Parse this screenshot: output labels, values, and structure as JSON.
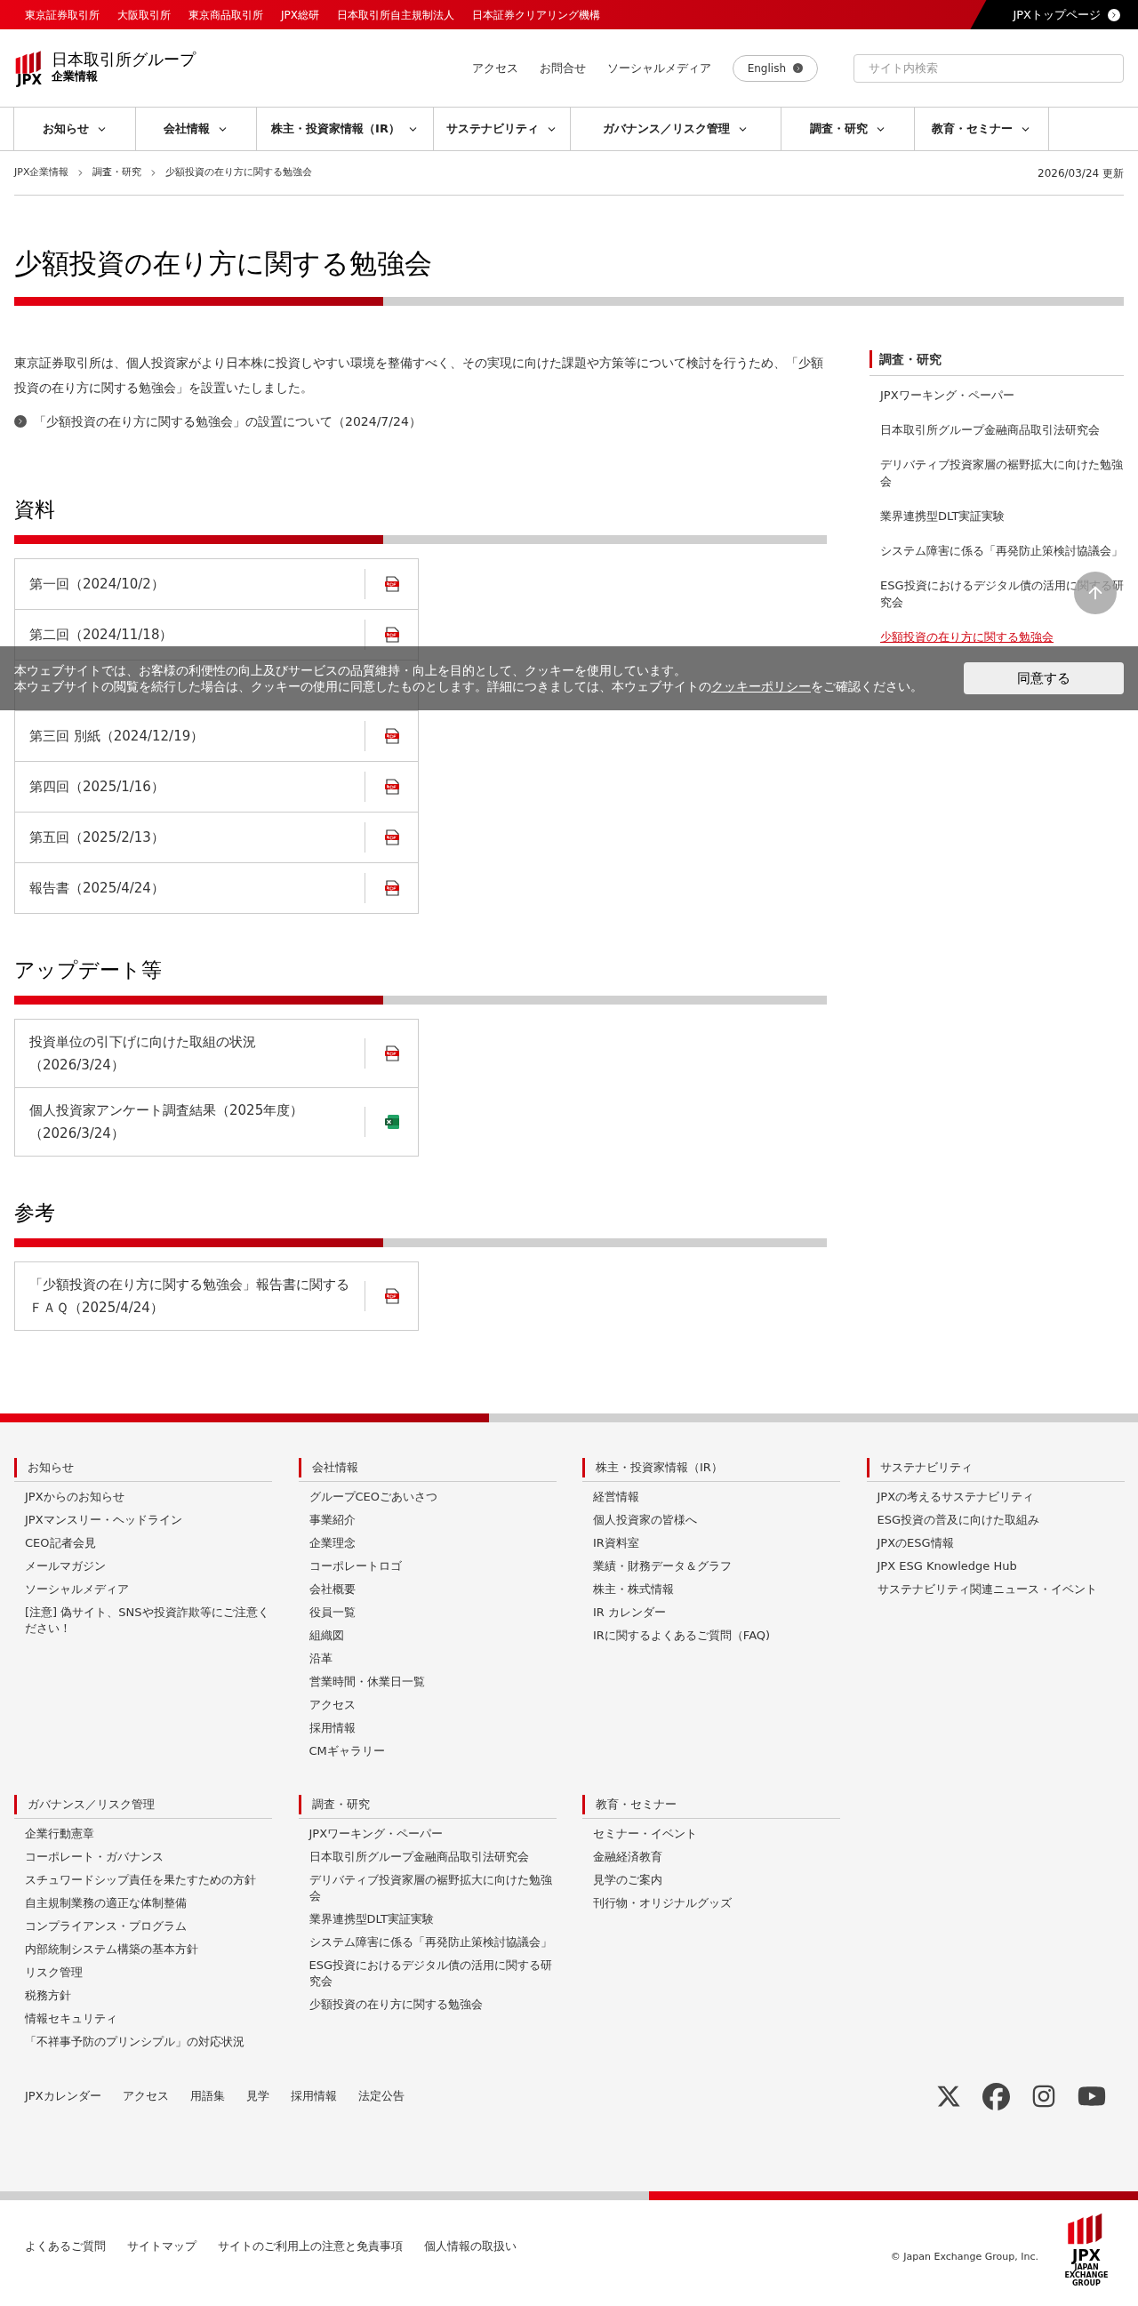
{
  "top_bar": {
    "links": [
      "東京証券取引所",
      "大阪取引所",
      "東京商品取引所",
      "JPX総研",
      "日本取引所自主規制法人",
      "日本証券クリアリング機構"
    ],
    "home_link": "JPXトップページ"
  },
  "header": {
    "logo_text": "JPX",
    "site_name": "日本取引所グループ",
    "site_sub": "企業情報",
    "links": [
      "アクセス",
      "お問合せ",
      "ソーシャルメディア"
    ],
    "language": "English",
    "search": {
      "placeholder": "サイト内検索"
    }
  },
  "nav": [
    "お知らせ",
    "会社情報",
    "株主・投資家情報（IR）",
    "サステナビリティ",
    "ガバナンス／リスク管理",
    "調査・研究",
    "教育・セミナー"
  ],
  "breadcrumb": [
    "JPX企業情報",
    "調査・研究",
    "少額投資の在り方に関する勉強会"
  ],
  "updated": "2026/03/24 更新",
  "title": "少額投資の在り方に関する勉強会",
  "intro": "東京証券取引所は、個人投資家がより日本株に投資しやすい環境を整備すべく、その実現に向けた課題や方策等について検討を行うため、「少額投資の在り方に関する勉強会」を設置いたしました。",
  "intro_link": "「少額投資の在り方に関する勉強会」の設置について（2024/7/24）",
  "sections": [
    {
      "heading": "資料",
      "items": [
        {
          "label": "第一回（2024/10/2）",
          "kind": "pdf"
        },
        {
          "label": "第二回（2024/11/18）",
          "kind": "pdf"
        },
        {
          "kind": "hidden"
        },
        {
          "label": "第三回 別紙（2024/12/19）",
          "kind": "pdf"
        },
        {
          "label": "第四回（2025/1/16）",
          "kind": "pdf"
        },
        {
          "label": "第五回（2025/2/13）",
          "kind": "pdf"
        },
        {
          "label": "報告書（2025/4/24）",
          "kind": "pdf"
        }
      ]
    },
    {
      "heading": "アップデート等",
      "items": [
        {
          "label": "投資単位の引下げに向けた取組の状況（2026/3/24）",
          "kind": "pdf"
        },
        {
          "label": "個人投資家アンケート調査結果（2025年度）（2026/3/24）",
          "kind": "excel"
        }
      ]
    },
    {
      "heading": "参考",
      "items": [
        {
          "label": "「少額投資の在り方に関する勉強会」報告書に関するＦＡＱ（2025/4/24）",
          "kind": "pdf"
        }
      ]
    }
  ],
  "sidebar": {
    "heading": "調査・研究",
    "items": [
      {
        "label": "JPXワーキング・ペーパー",
        "selected": false
      },
      {
        "label": "日本取引所グループ金融商品取引法研究会",
        "selected": false
      },
      {
        "label": "デリバティブ投資家層の裾野拡大に向けた勉強会",
        "selected": false
      },
      {
        "label": "業界連携型DLT実証実験",
        "selected": false
      },
      {
        "label": "システム障害に係る「再発防止策検討協議会」",
        "selected": false
      },
      {
        "label": "ESG投資におけるデジタル債の活用に関する研究会",
        "selected": false
      },
      {
        "label": "少額投資の在り方に関する勉強会",
        "selected": true
      }
    ]
  },
  "cookie_banner": {
    "line1": "本ウェブサイトでは、お客様の利便性の向上及びサービスの品質維持・向上を目的として、クッキーを使用しています。",
    "line2_before": "本ウェブサイトの閲覧を続行した場合は、クッキーの使用に同意したものとします。詳細につきましては、本ウェブサイトの",
    "line2_link": "クッキーポリシー",
    "line2_after": "をご確認ください。",
    "button": "同意する"
  },
  "footer": {
    "columns": [
      {
        "heading": "お知らせ",
        "links": [
          "JPXからのお知らせ",
          "JPXマンスリー・ヘッドライン",
          "CEO記者会見",
          "メールマガジン",
          "ソーシャルメディア",
          "[注意] 偽サイト、SNSや投資詐欺等にご注意ください！"
        ]
      },
      {
        "heading": "会社情報",
        "links": [
          "グループCEOごあいさつ",
          "事業紹介",
          "企業理念",
          "コーポレートロゴ",
          "会社概要",
          "役員一覧",
          "組織図",
          "沿革",
          "営業時間・休業日一覧",
          "アクセス",
          "採用情報",
          "CMギャラリー"
        ]
      },
      {
        "heading": "株主・投資家情報（IR）",
        "links": [
          "経営情報",
          "個人投資家の皆様へ",
          "IR資料室",
          "業績・財務データ＆グラフ",
          "株主・株式情報",
          "IR カレンダー",
          "IRに関するよくあるご質問（FAQ)"
        ]
      },
      {
        "heading": "サステナビリティ",
        "links": [
          "JPXの考えるサステナビリティ",
          "ESG投資の普及に向けた取組み",
          "JPXのESG情報",
          "JPX ESG Knowledge Hub",
          "サステナビリティ関連ニュース・イベント"
        ]
      },
      {
        "heading": "ガバナンス／リスク管理",
        "links": [
          "企業行動憲章",
          "コーポレート・ガバナンス",
          "スチュワードシップ責任を果たすための方針",
          "自主規制業務の適正な体制整備",
          "コンプライアンス・プログラム",
          "内部統制システム構築の基本方針",
          "リスク管理",
          "税務方針",
          "情報セキュリティ",
          "「不祥事予防のプリンシプル」の対応状況"
        ]
      },
      {
        "heading": "調査・研究",
        "links": [
          "JPXワーキング・ペーパー",
          "日本取引所グループ金融商品取引法研究会",
          "デリバティブ投資家層の裾野拡大に向けた勉強会",
          "業界連携型DLT実証実験",
          "システム障害に係る「再発防止策検討協議会」",
          "ESG投資におけるデジタル債の活用に関する研究会",
          "少額投資の在り方に関する勉強会"
        ]
      },
      {
        "heading": "教育・セミナー",
        "links": [
          "セミナー・イベント",
          "金融経済教育",
          "見学のご案内",
          "刊行物・オリジナルグッズ"
        ]
      }
    ],
    "bottom_links": [
      "JPXカレンダー",
      "アクセス",
      "用語集",
      "見学",
      "採用情報",
      "法定公告"
    ],
    "legal_links": [
      "よくあるご質問",
      "サイトマップ",
      "サイトのご利用上の注意と免責事項",
      "個人情報の取扱い"
    ],
    "copyright": "© Japan Exchange Group, Inc.",
    "logo_text": "JPX",
    "logo_sub": "JAPAN EXCHANGE GROUP"
  }
}
